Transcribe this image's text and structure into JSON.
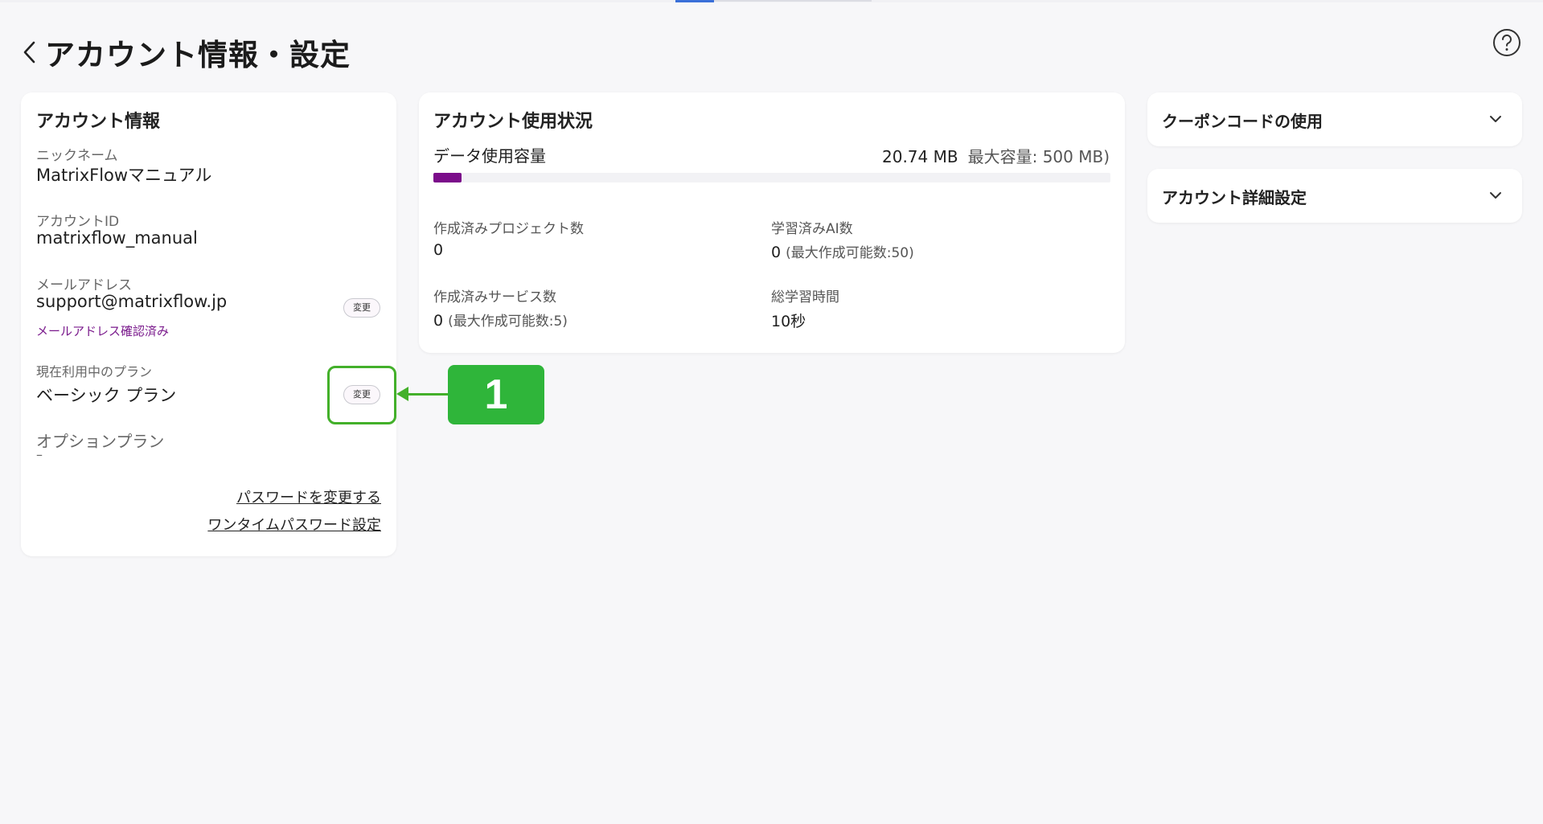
{
  "header": {
    "title": "アカウント情報・設定"
  },
  "account": {
    "title": "アカウント情報",
    "nickname_label": "ニックネーム",
    "nickname": "MatrixFlowマニュアル",
    "account_id_label": "アカウントID",
    "account_id": "matrixflow_manual",
    "email_label": "メールアドレス",
    "email": "support@matrixflow.jp",
    "email_change_label": "変更",
    "email_verified": "メールアドレス確認済み",
    "plan_label": "現在利用中のプラン",
    "plan": "ベーシック プラン",
    "plan_change_label": "変更",
    "option_label": "オプションプラン",
    "option_value": "–",
    "password_link": "パスワードを変更する",
    "otp_link": "ワンタイムパスワード設定"
  },
  "usage": {
    "title": "アカウント使用状況",
    "data_label": "データ使用容量",
    "data_used": "20.74 MB",
    "data_max": "最大容量: 500 MB)",
    "data_fraction": 0.0415,
    "projects_label": "作成済みプロジェクト数",
    "projects_value": "0",
    "ai_label": "学習済みAI数",
    "ai_value": "0",
    "ai_limit": "(最大作成可能数:50)",
    "services_label": "作成済みサービス数",
    "services_value": "0",
    "services_limit": "(最大作成可能数:5)",
    "training_label": "総学習時間",
    "training_value": "10秒"
  },
  "accordions": {
    "coupon": "クーポンコードの使用",
    "detail": "アカウント詳細設定"
  },
  "annotation": {
    "callout_number": "1"
  },
  "colors": {
    "accent": "#7b0c8a",
    "callout": "#2fb53a"
  }
}
